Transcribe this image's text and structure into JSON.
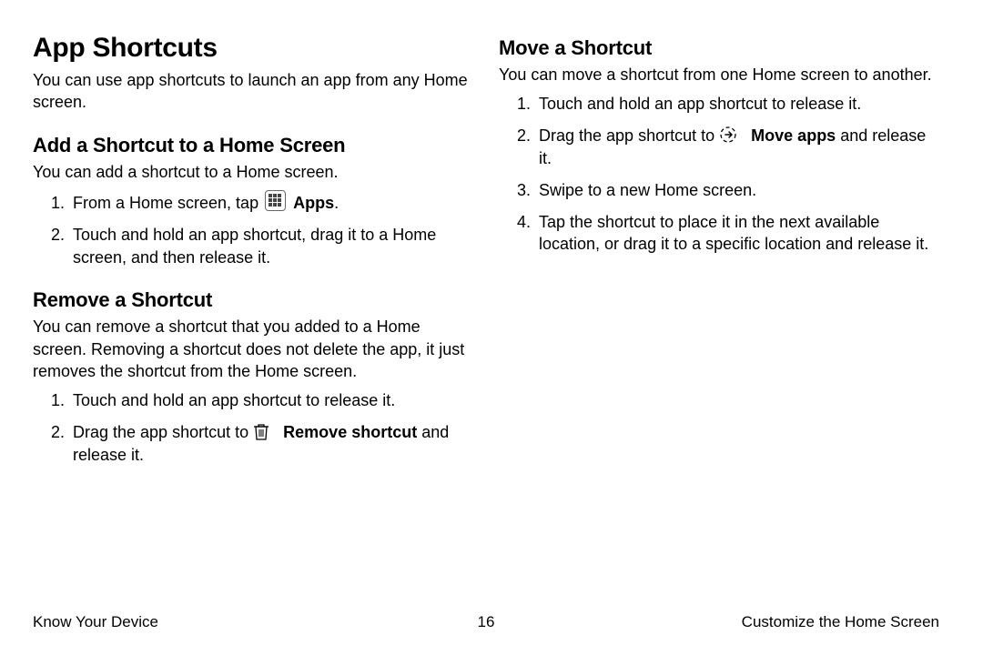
{
  "left": {
    "heading": "App Shortcuts",
    "intro": "You can use app shortcuts to launch an app from any Home screen.",
    "add": {
      "heading": "Add a Shortcut to a Home Screen",
      "intro": "You can add a shortcut to a Home screen.",
      "step1_pre": "From a Home screen, tap ",
      "step1_bold": "Apps",
      "step1_post": ".",
      "step2": "Touch and hold an app shortcut, drag it to a Home screen, and then release it."
    },
    "remove": {
      "heading": "Remove a Shortcut",
      "intro": "You can remove a shortcut that you added to a Home screen. Removing a shortcut does not delete the app, it just removes the shortcut from the Home screen.",
      "step1": "Touch and hold an app shortcut to release it.",
      "step2_pre": "Drag the app shortcut to ",
      "step2_bold": "Remove shortcut",
      "step2_post": " and release it."
    }
  },
  "right": {
    "move": {
      "heading": "Move a Shortcut",
      "intro": "You can move a shortcut from one Home screen to another.",
      "step1": "Touch and hold an app shortcut to release it.",
      "step2_pre": "Drag the app shortcut to ",
      "step2_bold": "Move apps",
      "step2_post": " and release it.",
      "step3": "Swipe to a new Home screen.",
      "step4": "Tap the shortcut to place it in the next available location, or drag it to a specific location and release it."
    }
  },
  "footer": {
    "left": "Know Your Device",
    "center": "16",
    "right": "Customize the Home Screen"
  }
}
